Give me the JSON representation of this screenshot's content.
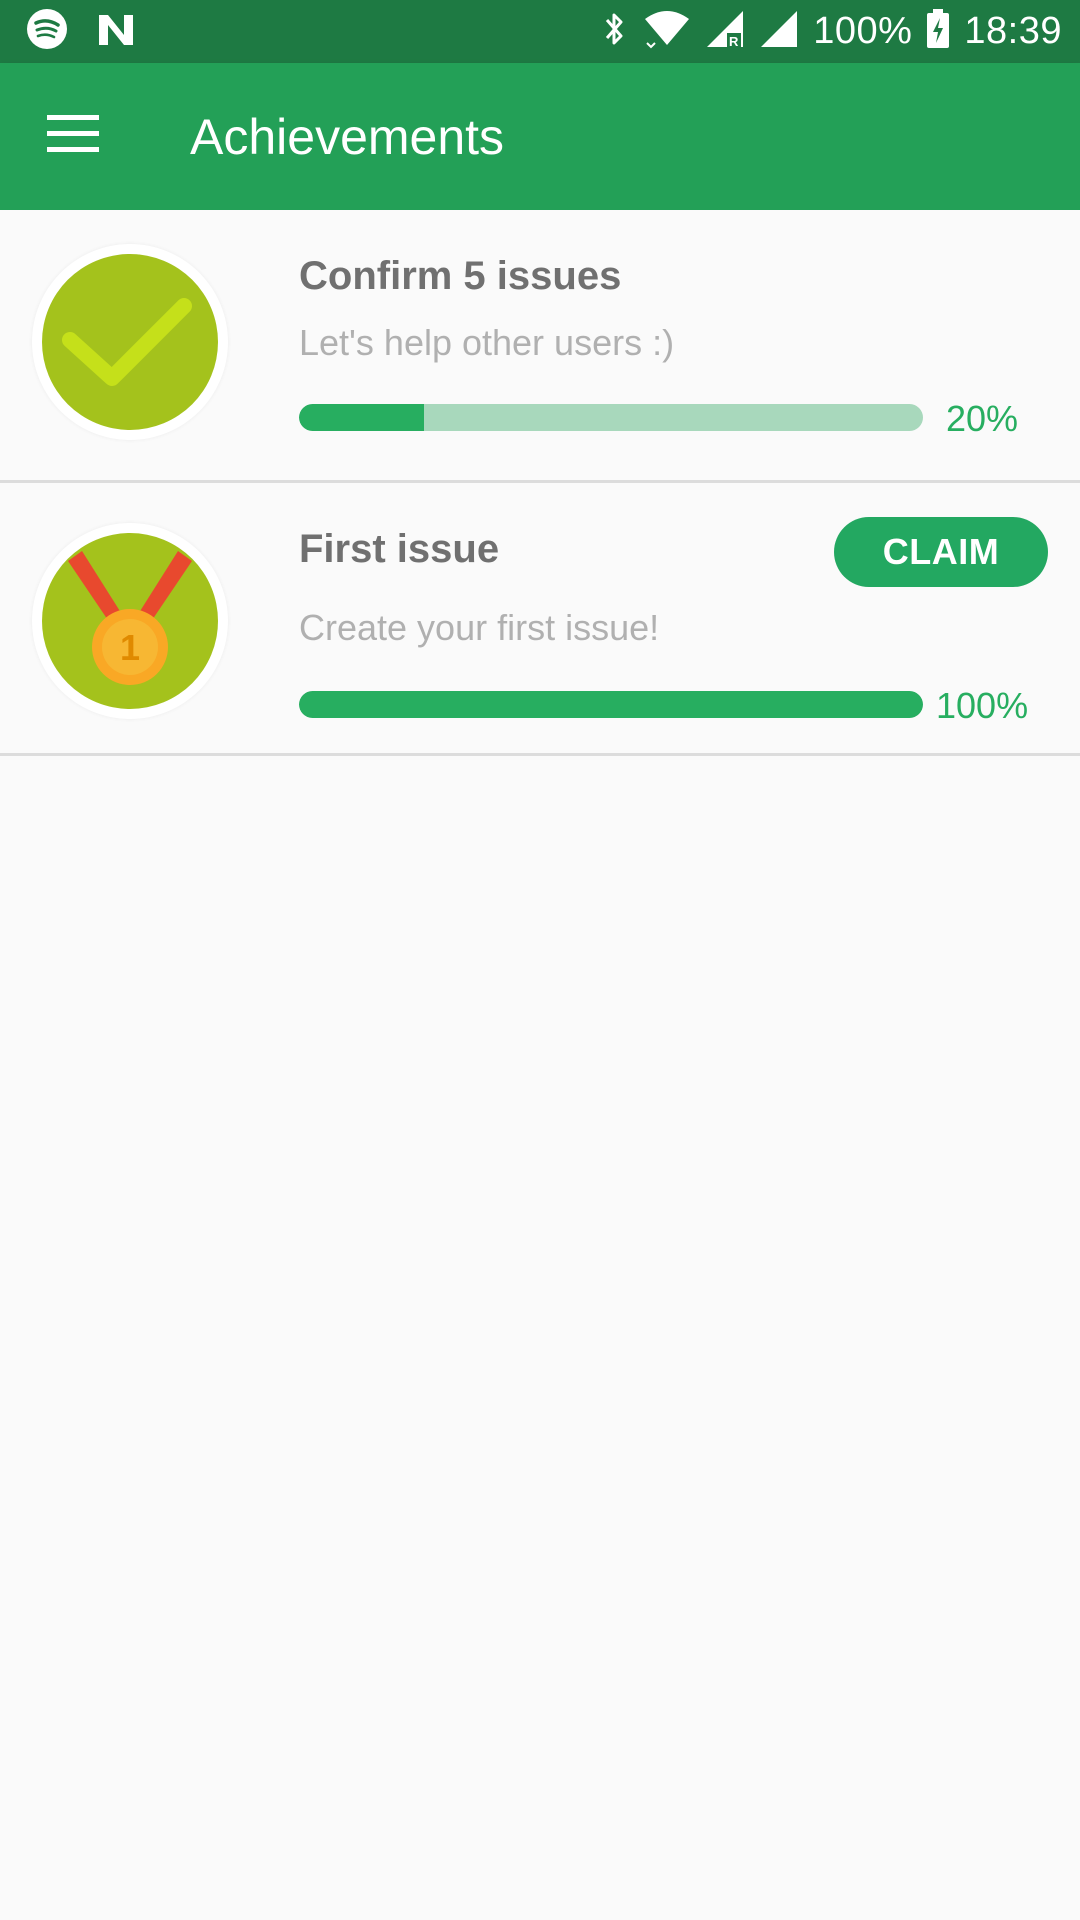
{
  "status_bar": {
    "battery": "100%",
    "time": "18:39",
    "icons": [
      "spotify-icon",
      "n-notification-icon",
      "bluetooth-icon",
      "wifi-icon",
      "cell-signal-roaming-icon",
      "cell-signal-icon",
      "battery-charging-icon"
    ]
  },
  "app_bar": {
    "title": "Achievements",
    "menu_icon": "hamburger-menu-icon"
  },
  "achievements": [
    {
      "title": "Confirm 5 issues",
      "subtitle": "Let's help other users :)",
      "progress": 20,
      "progress_label": "20%",
      "badge_icon": "checkmark-badge-icon"
    },
    {
      "title": "First issue",
      "subtitle": "Create your first issue!",
      "progress": 100,
      "progress_label": "100%",
      "badge_icon": "medal-badge-icon",
      "medal_number": "1",
      "claim_label": "CLAIM"
    }
  ],
  "colors": {
    "status_bar": "#1e7a43",
    "app_bar": "#23a057",
    "accent": "#27ae60",
    "progress_track": "#a8d8bc",
    "badge_green": "#a4c21c"
  }
}
